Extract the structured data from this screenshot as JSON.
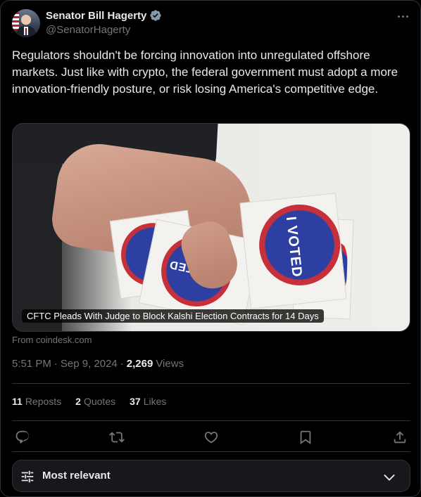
{
  "author": {
    "name": "Senator Bill Hagerty",
    "handle": "@SenatorHagerty"
  },
  "tweet": {
    "text": "Regulators shouldn't be forcing innovation into unregulated offshore markets. Just like with crypto, the federal government must adopt a more innovation-friendly posture, or risk losing America's competitive edge."
  },
  "card": {
    "caption": "CFTC Pleads With Judge to Block Kalshi Election Contracts for 14 Days",
    "sticker_text": "I VOTED",
    "source": "From coindesk.com"
  },
  "meta": {
    "time": "5:51 PM",
    "separator": "·",
    "date": "Sep 9, 2024",
    "views_count": "2,269",
    "views_label": "Views"
  },
  "stats": {
    "reposts_count": "11",
    "reposts_label": "Reposts",
    "quotes_count": "2",
    "quotes_label": "Quotes",
    "likes_count": "37",
    "likes_label": "Likes"
  },
  "sort": {
    "label": "Most relevant"
  },
  "icons": {
    "verified": "verified-badge-icon",
    "more": "more-icon",
    "reply": "reply-icon",
    "repost": "repost-icon",
    "like": "like-icon",
    "bookmark": "bookmark-icon",
    "share": "share-icon",
    "sort": "sliders-icon",
    "chevron": "chevron-down-icon"
  },
  "colors": {
    "background": "#000000",
    "text": "#e7e9ea",
    "muted": "#71767b",
    "border": "#2f3336",
    "verified": "#829aab"
  }
}
